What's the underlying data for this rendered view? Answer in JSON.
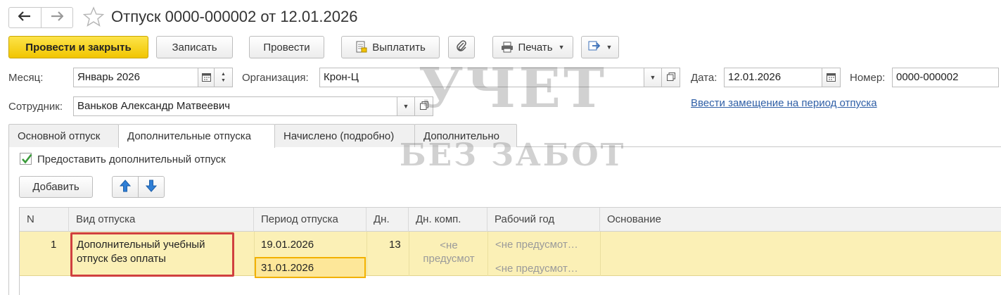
{
  "header": {
    "title": "Отпуск 0000-000002 от 12.01.2026",
    "back_icon": "arrow-left-icon",
    "forward_icon": "arrow-right-icon",
    "favorite_icon": "star-icon"
  },
  "toolbar": {
    "post_close_label": "Провести и закрыть",
    "save_label": "Записать",
    "post_label": "Провести",
    "pay_label": "Выплатить",
    "print_label": "Печать"
  },
  "form": {
    "month_label": "Месяц:",
    "month_value": "Январь 2026",
    "org_label": "Организация:",
    "org_value": "Крон-Ц",
    "date_label": "Дата:",
    "date_value": "12.01.2026",
    "number_label": "Номер:",
    "number_value": "0000-000002",
    "employee_label": "Сотрудник:",
    "employee_value": "Ваньков Александр Матвеевич",
    "replacement_link": "Ввести замещение на период отпуска"
  },
  "tabs": [
    {
      "label": "Основной отпуск"
    },
    {
      "label": "Дополнительные отпуска"
    },
    {
      "label": "Начислено (подробно)"
    },
    {
      "label": "Дополнительно"
    }
  ],
  "additional": {
    "grant_label": "Предоставить дополнительный отпуск",
    "grant_checked": true,
    "add_label": "Добавить",
    "up_icon": "arrow-up-icon",
    "down_icon": "arrow-down-icon"
  },
  "table": {
    "columns": [
      "N",
      "Вид отпуска",
      "Период отпуска",
      "Дн.",
      "Дн. комп.",
      "Рабочий год",
      "Основание"
    ],
    "rows": [
      {
        "n": "1",
        "type_line1": "Дополнительный учебный",
        "type_line2": "отпуск без оплаты",
        "period_start": "19.01.2026",
        "period_end": "31.01.2026",
        "days": "13",
        "comp_days_line1": "<не",
        "comp_days_line2": "предусмот",
        "work_year_start": "<не предусмот…",
        "work_year_end": "<не предусмот…",
        "basis": ""
      }
    ]
  },
  "watermark": {
    "line1": "УЧЕТ",
    "line2": "БЕЗ ЗАБОТ"
  },
  "colors": {
    "primary_button": "#f5d31c",
    "row_highlight": "#fbf0b6",
    "link": "#2f5fa6",
    "check": "#3a9b3a",
    "arrow_blue": "#2f7fd6",
    "annotation_red": "#d04040",
    "annotation_orange": "#f2b100"
  }
}
